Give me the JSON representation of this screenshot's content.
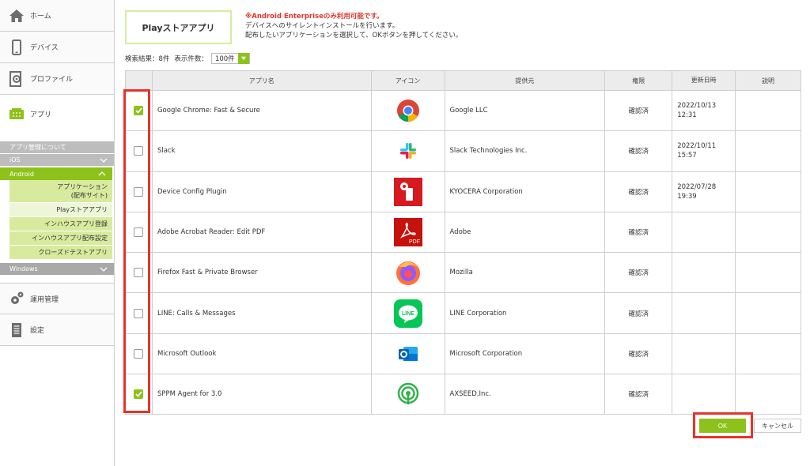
{
  "sidebar": {
    "home": "ホーム",
    "device": "デバイス",
    "profile": "プロファイル",
    "app": "アプリ",
    "app_about": "アプリ管理について",
    "ios": "iOS",
    "android": "Android",
    "android_items": [
      "アプリケーション\n(配布サイト)",
      "Playストアアプリ",
      "インハウスアプリ登録",
      "インハウスアプリ配布設定",
      "クローズドテストアプリ"
    ],
    "windows": "Windows",
    "operation": "運用管理",
    "settings": "設定"
  },
  "page": {
    "title": "Playストアアプリ",
    "warning": "※Android Enterpriseのみ利用可能です。",
    "note1": "デバイスへのサイレントインストールを行います。",
    "note2": "配布したいアプリケーションを選択して、OKボタンを押してください。",
    "result_label": "検索結果：8件",
    "count_label": "表示件数：",
    "count_value": "100件"
  },
  "table": {
    "headers": [
      "アプリ名",
      "アイコン",
      "提供元",
      "権限",
      "更新日時",
      "説明"
    ],
    "rows": [
      {
        "checked": true,
        "name": "Google Chrome: Fast & Secure",
        "icon": "chrome-icon",
        "provider": "Google LLC",
        "perm": "確認済",
        "date1": "2022/10/13",
        "date2": "12:31"
      },
      {
        "checked": false,
        "name": "Slack",
        "icon": "slack-icon",
        "provider": "Slack Technologies Inc.",
        "perm": "確認済",
        "date1": "2022/10/11",
        "date2": "15:57"
      },
      {
        "checked": false,
        "name": "Device Config Plugin",
        "icon": "device-config-icon",
        "provider": "KYOCERA Corporation",
        "perm": "確認済",
        "date1": "2022/07/28",
        "date2": "19:39"
      },
      {
        "checked": false,
        "name": "Adobe Acrobat Reader: Edit PDF",
        "icon": "acrobat-icon",
        "provider": "Adobe",
        "perm": "確認済",
        "date1": "",
        "date2": ""
      },
      {
        "checked": false,
        "name": "Firefox Fast & Private Browser",
        "icon": "firefox-icon",
        "provider": "Mozilla",
        "perm": "確認済",
        "date1": "",
        "date2": ""
      },
      {
        "checked": false,
        "name": "LINE: Calls & Messages",
        "icon": "line-icon",
        "provider": "LINE Corporation",
        "perm": "確認済",
        "date1": "",
        "date2": ""
      },
      {
        "checked": false,
        "name": "Microsoft Outlook",
        "icon": "outlook-icon",
        "provider": "Microsoft Corporation",
        "perm": "確認済",
        "date1": "",
        "date2": ""
      },
      {
        "checked": true,
        "name": "SPPM Agent for 3.0",
        "icon": "sppm-icon",
        "provider": "AXSEED,Inc.",
        "perm": "確認済",
        "date1": "",
        "date2": ""
      }
    ]
  },
  "buttons": {
    "ok": "OK",
    "cancel": "キャンセル"
  },
  "colors": {
    "accent": "#8cc21a",
    "highlight": "#e8322a"
  }
}
